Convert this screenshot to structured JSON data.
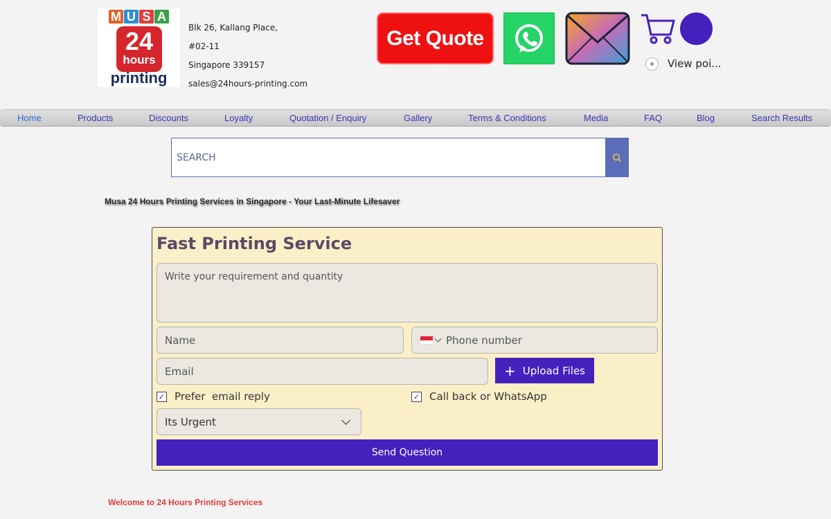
{
  "header": {
    "logo": {
      "letters": [
        "M",
        "U",
        "S",
        "A"
      ],
      "letter_colors": [
        "#e3612b",
        "#2b8fd0",
        "#e23c3c",
        "#3aa24a"
      ],
      "number": "24",
      "hours": "hours",
      "word": "printing"
    },
    "address": [
      "Blk 26, Kallang Place,",
      "#02-11",
      "Singapore 339157",
      "sales@24hours-printing.com"
    ],
    "get_quote_label": "Get Quote",
    "points_label": "View poi..."
  },
  "nav": {
    "items": [
      {
        "label": "Home"
      },
      {
        "label": "Products"
      },
      {
        "label": "Discounts"
      },
      {
        "label": "Loyalty"
      },
      {
        "label": "Quotation / Enquiry"
      },
      {
        "label": "Gallery"
      },
      {
        "label": "Terms & Conditions"
      },
      {
        "label": "Media"
      },
      {
        "label": "FAQ"
      },
      {
        "label": "Blog"
      },
      {
        "label": "Search Results"
      }
    ]
  },
  "search": {
    "placeholder": "SEARCH"
  },
  "tagline": "Musa 24 Hours Printing Services in Singapore - Your Last-Minute Lifesaver",
  "form": {
    "title": "Fast Printing Service",
    "requirement_placeholder": "Write your requirement and quantity",
    "name_placeholder": "Name",
    "phone_placeholder": "Phone number",
    "email_placeholder": "Email",
    "upload_label": "Upload Files",
    "prefer_email_label": "Prefer  email reply",
    "callback_label": "Call back or WhatsApp",
    "urgency_value": "Its Urgent",
    "send_label": "Send Question"
  },
  "welcome": "Welcome to 24 Hours Printing Services",
  "colors": {
    "accent": "#4520bd",
    "quote_red": "#ef1111",
    "whatsapp_green": "#25d366",
    "form_bg": "#fbefc8",
    "nav_text": "#3a35b0"
  }
}
